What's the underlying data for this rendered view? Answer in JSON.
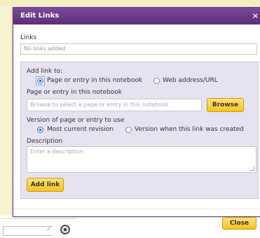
{
  "background": {
    "top_right_mark": "...",
    "bottom_check": "✓"
  },
  "dialog": {
    "title": "Edit Links",
    "close_glyph": "×",
    "links_label": "Links",
    "links_value": "No links added",
    "add_link_to_label": "Add link to:",
    "option_page_entry": "Page or entry in this notebook",
    "option_web": "Web address/URL",
    "page_entry_label": "Page or entry in this notebook",
    "page_entry_placeholder": "Browse to select a page or entry in this notebook",
    "browse_label": "Browse",
    "version_label": "Version of page or entry to use",
    "option_current": "Most current revision",
    "option_created": "Version when this link was created",
    "description_label": "Description",
    "description_placeholder": "Enter a description",
    "add_link_label": "Add link",
    "close_label": "Close"
  },
  "colors": {
    "titlebar": "#6a3a84",
    "panel": "#e7e2f0",
    "button": "#f7c21f"
  }
}
